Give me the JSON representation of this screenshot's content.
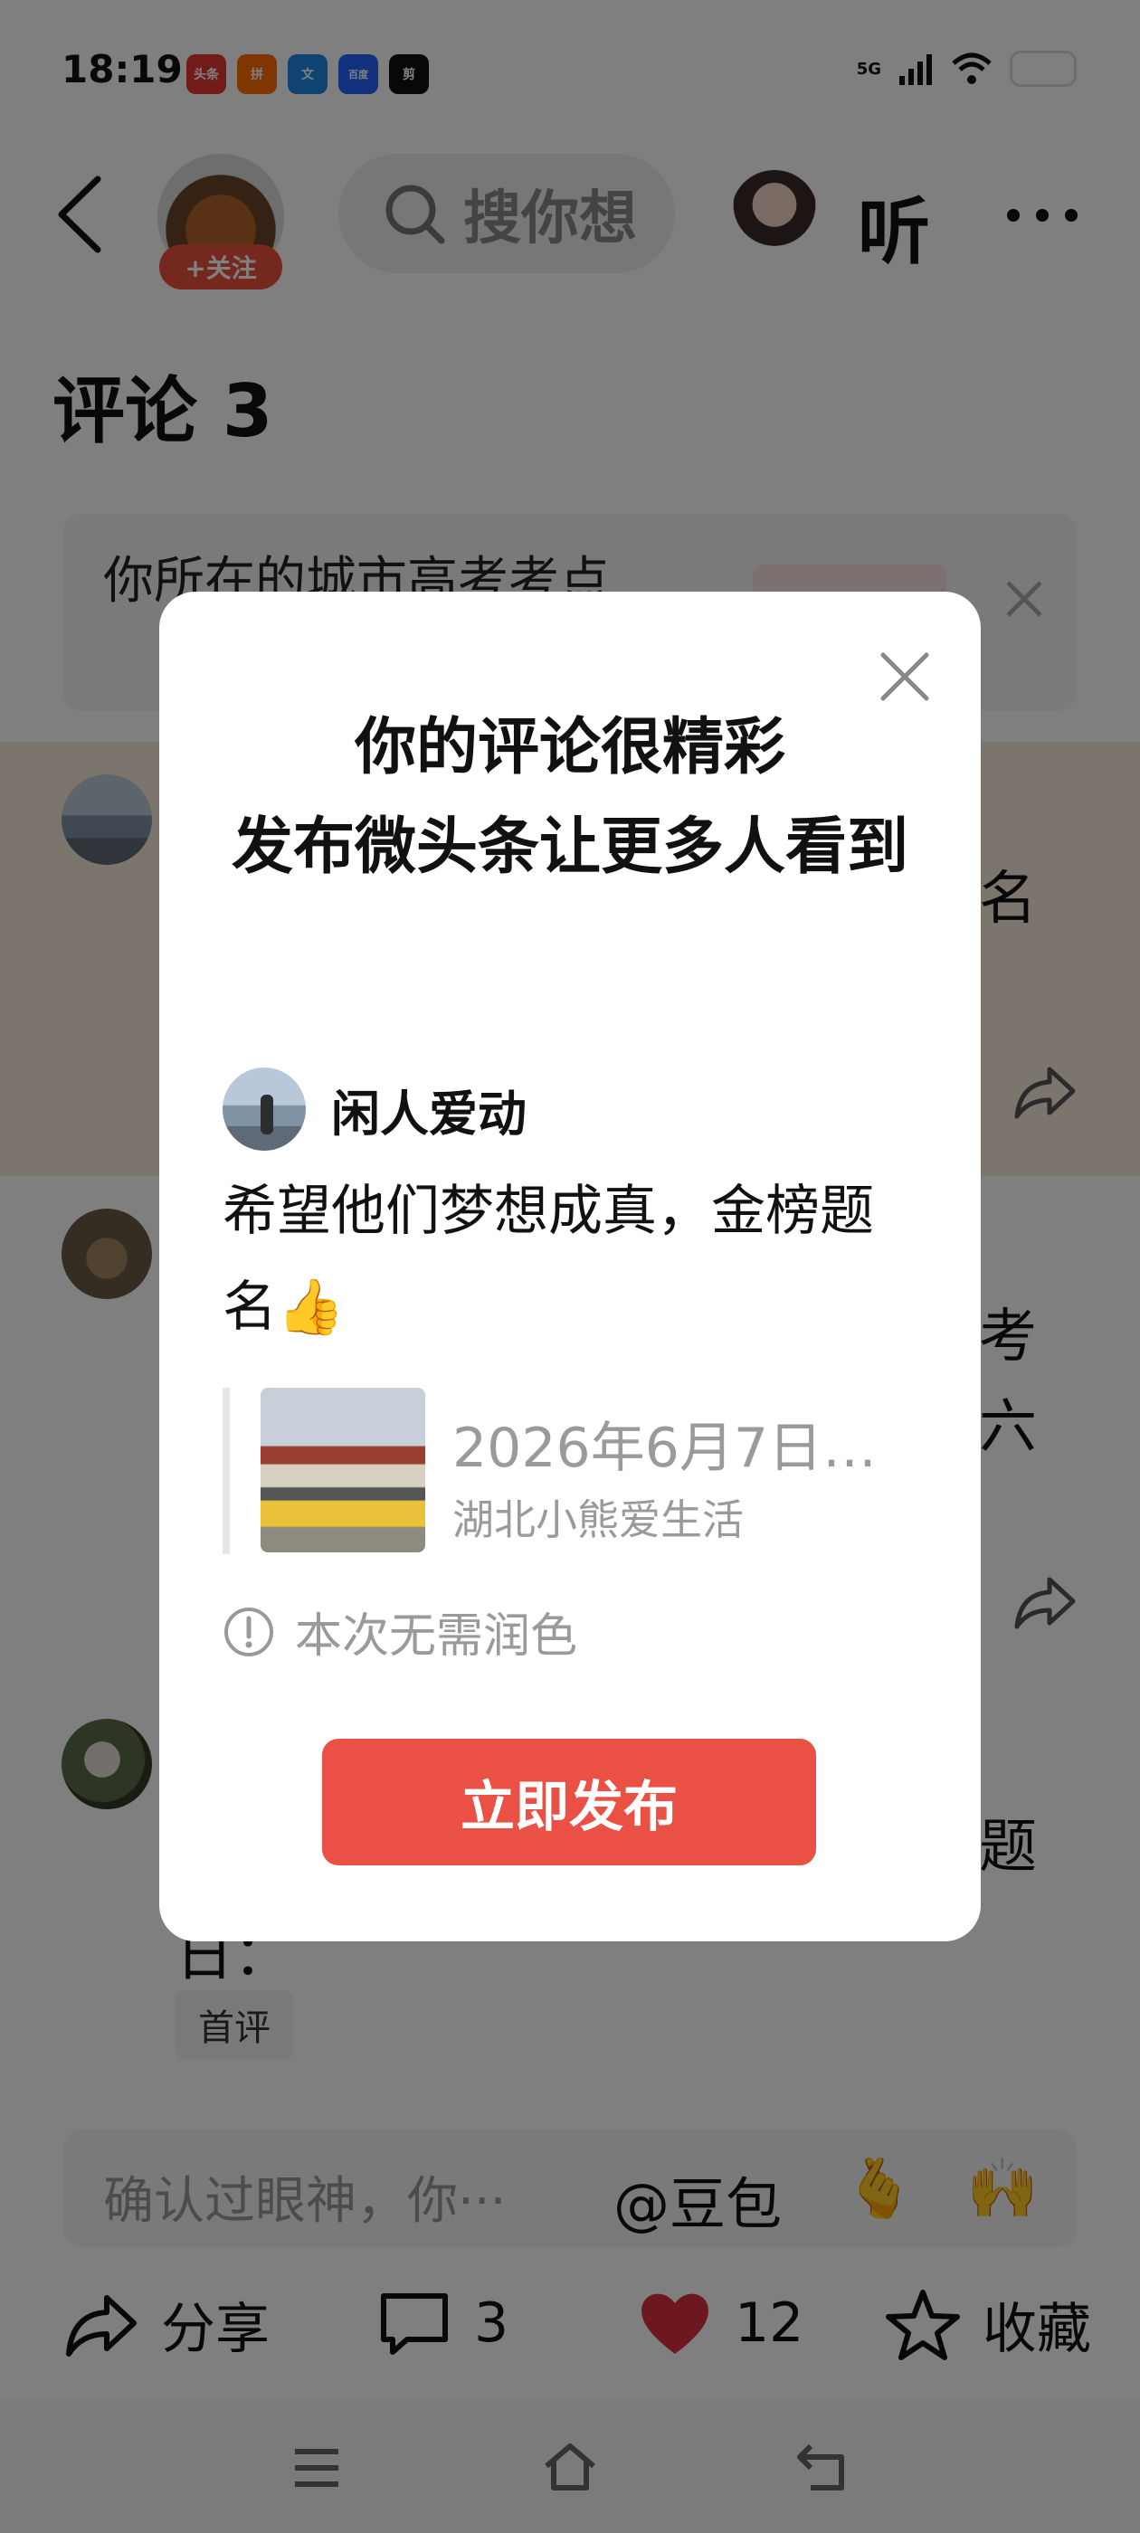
{
  "status_bar": {
    "time": "18:19",
    "app_icons": [
      "头条",
      "拼",
      "文",
      "百度",
      "剪"
    ],
    "network": "5G"
  },
  "header": {
    "follow_label": "+关注",
    "search_placeholder": "搜你想",
    "listen_label": "听"
  },
  "comments_section": {
    "title": "评论 3",
    "city_banner_text": "你所在的城市高考考点",
    "comment_fragments": [
      "名",
      "考",
      "六",
      "题",
      "日："
    ],
    "first_comment_tag": "首评"
  },
  "input_bar": {
    "placeholder": "确认过眼神，你···",
    "mention": "@豆包",
    "emoji_1": "🫰",
    "emoji_2": "🙌"
  },
  "actions": {
    "share_label": "分享",
    "comment_count": "3",
    "like_count": "12",
    "collect_label": "收藏"
  },
  "modal": {
    "title": "你的评论很精彩\n发布微头条让更多人看到",
    "author_name": "闲人爱动",
    "comment_text": "希望他们梦想成真，金榜题名",
    "comment_emoji": "👍",
    "quote_title": "2026年6月7日…",
    "quote_source": "湖北小熊爱生活",
    "notice": "本次无需润色",
    "publish_label": "立即发布"
  },
  "colors": {
    "accent_red": "#ea5144",
    "like_red": "#d8303c",
    "overlay": "rgba(0,0,0,0.5)"
  }
}
